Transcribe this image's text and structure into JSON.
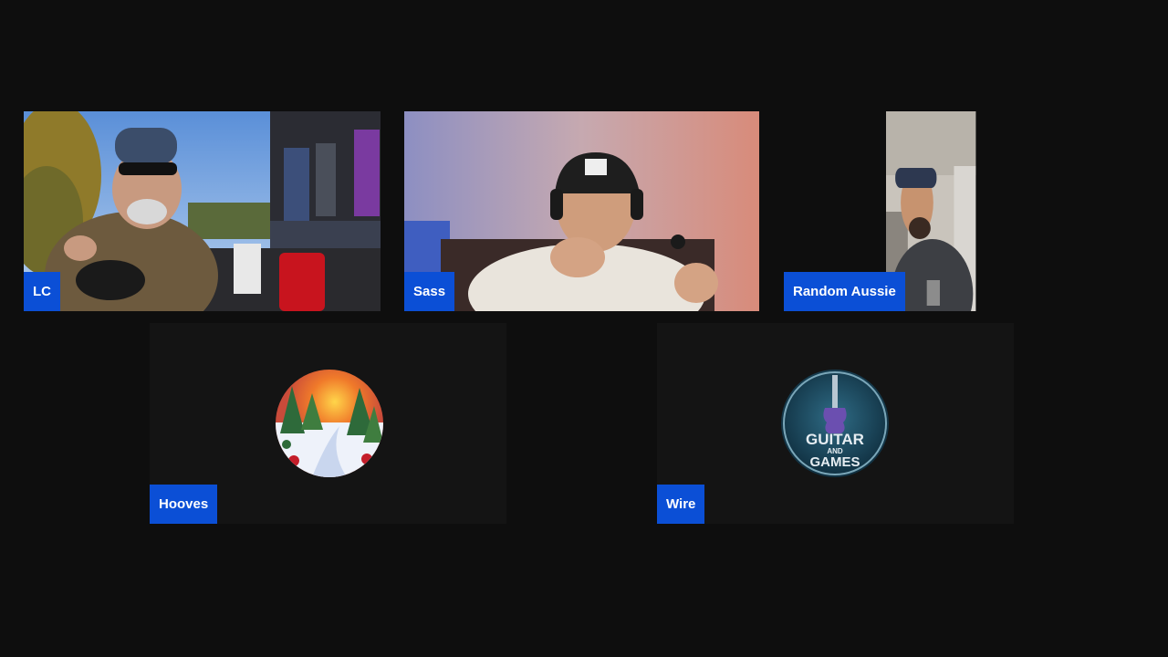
{
  "participants": [
    {
      "name": "LC",
      "type": "video"
    },
    {
      "name": "Sass",
      "type": "video"
    },
    {
      "name": "Random Aussie",
      "type": "video"
    },
    {
      "name": "Hooves",
      "type": "avatar",
      "avatar_icon": "winter-landscape-avatar-icon"
    },
    {
      "name": "Wire",
      "type": "avatar",
      "avatar_icon": "guitar-and-games-logo-icon",
      "avatar_logo_text": [
        "GUITAR",
        "AND",
        "GAMES"
      ]
    }
  ],
  "colors": {
    "background": "#0e0e0e",
    "tile_background": "#141414",
    "name_tag": "#0b4fd6",
    "name_tag_text": "#ffffff"
  }
}
